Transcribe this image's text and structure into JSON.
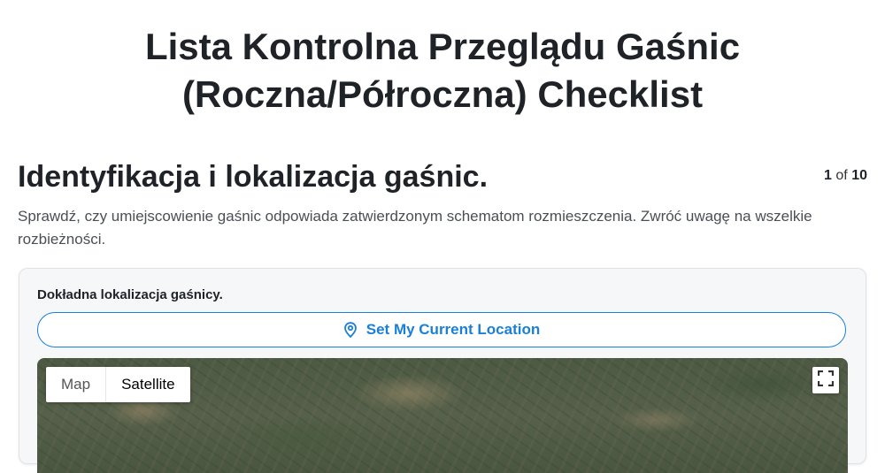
{
  "doc_title_line1": "Lista Kontrolna Przeglądu Gaśnic",
  "doc_title_line2": "(Roczna/Półroczna) Checklist",
  "section": {
    "title": "Identyfikacja i lokalizacja gaśnic.",
    "description": "Sprawdź, czy umiejscowienie gaśnic odpowiada zatwierdzonym schematom rozmieszczenia. Zwróć uwagę na wszelkie rozbieżności.",
    "page_current": "1",
    "page_of": "of",
    "page_total": "10"
  },
  "location_field": {
    "label": "Dokładna lokalizacja gaśnicy.",
    "button_label": "Set My Current Location",
    "button_icon": "map-pin-icon",
    "accent_color": "#1a7fd8"
  },
  "map": {
    "type_options": [
      "Map",
      "Satellite"
    ],
    "selected_type": "Satellite",
    "fullscreen_icon": "fullscreen-icon"
  }
}
